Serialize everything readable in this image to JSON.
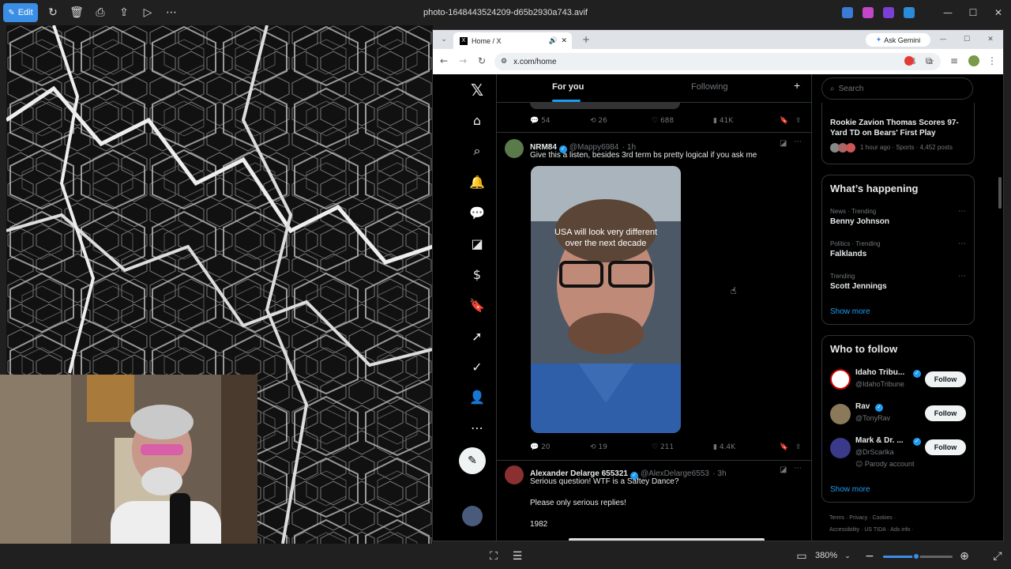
{
  "viewer": {
    "edit_label": "Edit",
    "file_title": "photo-1648443524209-d65b2930a743.avif",
    "zoom_level": "380%",
    "toolbar_icons": [
      "rotate-icon",
      "delete-icon",
      "print-icon",
      "share-icon",
      "slideshow-icon",
      "more-icon"
    ]
  },
  "browser": {
    "tab_title": "Home / X",
    "url": "x.com/home",
    "gemini_label": "Ask Gemini"
  },
  "x": {
    "tabs": {
      "for_you": "For you",
      "following": "Following"
    },
    "search_placeholder": "Search",
    "first_tweet_actions": {
      "replies": "54",
      "reposts": "26",
      "likes": "688",
      "views": "41K"
    },
    "tweet1": {
      "name": "NRM84",
      "handle": "@Mappy6984",
      "time": "· 1h",
      "text": "Give this a listen, besides 3rd term bs pretty logical if you ask me",
      "video_caption_1": "USA will look very different",
      "video_caption_2": "over the next decade",
      "replies": "20",
      "reposts": "19",
      "likes": "211",
      "views": "4.4K"
    },
    "tweet2": {
      "name": "Alexander Delarge 655321",
      "handle": "@AlexDelarge6553",
      "time": "· 3h",
      "line1": "Serious question! WTF is a Saftey Dance?",
      "line2": "Please only serious replies!",
      "line3": "1982"
    },
    "top_news": {
      "title_1": "Rookie Zavion Thomas Scores 97-",
      "title_2": "Yard TD on Bears' First Play",
      "meta": "1 hour ago · Sports · 4,452 posts"
    },
    "whats_happening": {
      "heading": "What’s happening",
      "trends": [
        {
          "category": "News · Trending",
          "name": "Benny Johnson"
        },
        {
          "category": "Politics · Trending",
          "name": "Falklands"
        },
        {
          "category": "Trending",
          "name": "Scott Jennings"
        }
      ],
      "show_more": "Show more"
    },
    "who_to_follow": {
      "heading": "Who to follow",
      "accounts": [
        {
          "name": "Idaho Tribu...",
          "handle": "@IdahoTribune",
          "button": "Follow"
        },
        {
          "name": "Rav",
          "handle": "@TonyRav",
          "button": "Follow"
        },
        {
          "name": "Mark & Dr. ...",
          "handle": "@DrScarlka",
          "note": "Parody account",
          "button": "Follow"
        }
      ],
      "show_more": "Show more"
    },
    "footer": {
      "line1": "Terms · Privacy · Cookies ·",
      "line2": "Accessibility · US TIDA · Ads info ·"
    }
  },
  "colors": {
    "accent": "#1d9bf0",
    "edit_button": "#3a8ee6"
  }
}
